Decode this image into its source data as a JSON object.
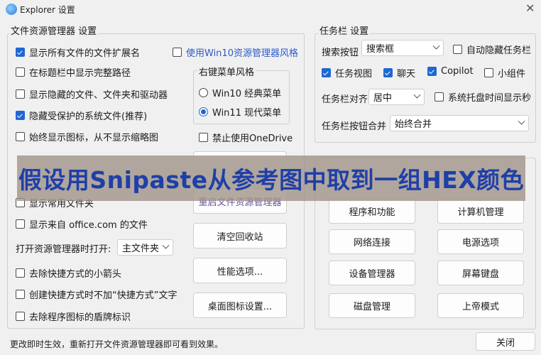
{
  "window": {
    "title": "Explorer 设置"
  },
  "explorer": {
    "group_title": "文件资源管理器 设置",
    "checkboxes": [
      {
        "label": "显示所有文件的文件扩展名",
        "checked": true
      },
      {
        "label": "在标题栏中显示完整路径",
        "checked": false
      },
      {
        "label": "显示隐藏的文件、文件夹和驱动器",
        "checked": false
      },
      {
        "label": "隐藏受保护的系统文件(推荐)",
        "checked": true
      },
      {
        "label": "始终显示图标，从不显示缩略图",
        "checked": false
      },
      {
        "label": "显示常用文件夹",
        "checked": false
      },
      {
        "label": "显示来自 office.com 的文件",
        "checked": false
      }
    ],
    "win10_style_label": "使用Win10资源管理器风格",
    "context_menu": {
      "title": "右键菜单风格",
      "win10": "Win10 经典菜单",
      "win11": "Win11 现代菜单"
    },
    "disable_onedrive": "禁止使用OneDrive",
    "open_at": {
      "label": "打开资源管理器时打开:",
      "value": "主文件夹"
    },
    "checkboxes_bottom": [
      {
        "label": "去除快捷方式的小箭头",
        "checked": false
      },
      {
        "label": "创建快捷方式时不加“快捷方式”文字",
        "checked": false
      },
      {
        "label": "去除程序图标的盾牌标识",
        "checked": false
      }
    ],
    "buttons": {
      "restart": "重启文件资源管理器",
      "empty_recycle": "清空回收站",
      "perf": "性能选项...",
      "desktop_icons": "桌面图标设置..."
    }
  },
  "taskbar": {
    "group_title": "任务栏 设置",
    "search_label": "搜索按钮",
    "search_value": "搜索框",
    "autohide": "自动隐藏任务栏",
    "task_view": "任务视图",
    "chat": "聊天",
    "copilot": "Copilot",
    "widgets": "小组件",
    "align_label": "任务栏对齐",
    "align_value": "居中",
    "tray_seconds": "系统托盘时间显示秒",
    "merge_label": "任务栏按钮合并",
    "merge_value": "始终合并"
  },
  "shortcuts": {
    "buttons": [
      "程序和功能",
      "计算机管理",
      "网络连接",
      "电源选项",
      "设备管理器",
      "屏幕键盘",
      "磁盘管理",
      "上帝模式"
    ]
  },
  "overlay_text": "假设用Snipaste从参考图中取到一组HEX颜色",
  "footer_text": "更改即时生效，重新打开文件资源管理器即可看到效果。",
  "close_label": "关闭"
}
